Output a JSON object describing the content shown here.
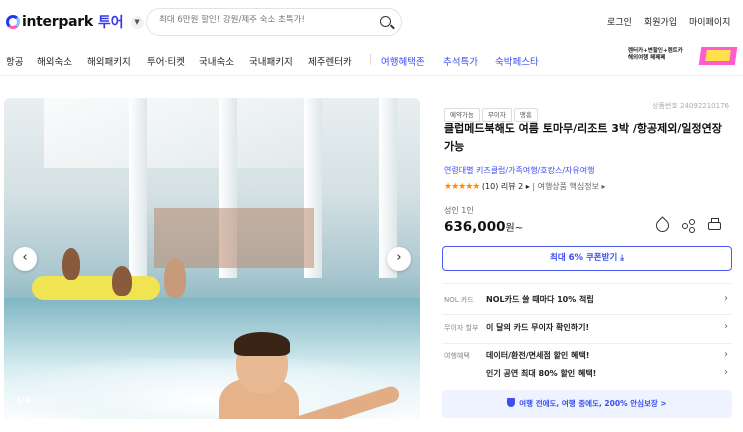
{
  "header": {
    "logo_text": "interpark",
    "logo_tour": "투어",
    "search_placeholder": "최대 6만원 할인! 강원/제주 숙소 초특가!",
    "login": "로그인",
    "signup": "회원가입",
    "mypage": "마이페이지"
  },
  "nav": {
    "items": [
      "항공",
      "해외숙소",
      "해외패키지",
      "투어·티켓",
      "국내숙소",
      "국내패키지",
      "제주렌터카"
    ],
    "blue_items": [
      "여행혜택존",
      "추석특가",
      "숙박페스타"
    ],
    "promo_line1": "렌터카+변할인+렌트카",
    "promo_line2": "해외여행 페페페"
  },
  "hero": {
    "counter": "1/4",
    "prev": "‹",
    "next": "›"
  },
  "product": {
    "chips": [
      "예약가능",
      "무이자",
      "맹흥"
    ],
    "product_no": "상품번호 24092210176",
    "title": "클럽메드북해도 여름 토마무/리조트 3박 /항공제외/일정연장가능",
    "tags": "연령대별 키즈클럽/가족여행/호캉스/자유여행",
    "stars": "★★★★★",
    "rating_count": "(10)",
    "review": "리뷰 2 ▸",
    "core_info": "여행상품 핵심정보 ▸",
    "pax": "성인 1인",
    "price": "636,000",
    "price_unit": "원~",
    "coupon": "최대 6% 쿠폰받기 ⤓"
  },
  "benefits": [
    {
      "label": "NOL 카드",
      "text": "NOL카드 쓸 때마다 10% 적립"
    },
    {
      "label": "무이자 할부",
      "text": "이 달의 카드 무이자 확인하기!"
    },
    {
      "label": "여행혜택",
      "text": "데이터/환전/면세점 할인 혜택!"
    },
    {
      "label": "",
      "text": "인기 공연 최대 80% 할인 혜택!"
    }
  ],
  "guarantee": "여행 전에도, 여행 중에도, 200% 안심보장 >"
}
